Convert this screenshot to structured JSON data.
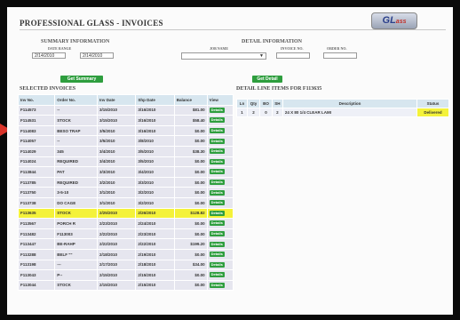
{
  "header": {
    "title": "PROFESSIONAL GLASS - INVOICES",
    "logo_text": "GL",
    "logo_sub": "ass"
  },
  "summary": {
    "heading": "SUMMARY INFORMATION",
    "date_range_label": "DATE RANGE",
    "date_from": "2/14/2010",
    "date_to": "2/14/2010",
    "button": "Get Summary"
  },
  "detail": {
    "heading": "DETAIL INFORMATION",
    "job_name_label": "JOB NAME",
    "invoice_no_label": "INVOICE NO.",
    "order_no_label": "ORDER NO.",
    "button": "Get Detail"
  },
  "invoices": {
    "heading": "SELECTED INVOICES",
    "columns": [
      "Inv No.",
      "Order No.",
      "Inv Date",
      "Shp Date",
      "Balance",
      "View"
    ],
    "rows": [
      [
        "F114573",
        "--",
        "3/15/2010",
        "3/16/2010",
        "$81.00",
        "Details"
      ],
      [
        "F114531",
        "STOCK",
        "3/15/2010",
        "3/16/2010",
        "$58.40",
        "Details"
      ],
      [
        "F114083",
        "BESO TRAP",
        "3/5/2010",
        "3/16/2010",
        "$0.00",
        "Details"
      ],
      [
        "F114057",
        "--",
        "3/5/2010",
        "3/8/2010",
        "$0.00",
        "Details"
      ],
      [
        "F114029",
        "345",
        "3/4/2010",
        "3/5/2010",
        "$38.30",
        "Details"
      ],
      [
        "F114024",
        "REQUIRED",
        "3/4/2010",
        "3/5/2010",
        "$0.00",
        "Details"
      ],
      [
        "F113844",
        "PAT",
        "3/3/2010",
        "3/4/2010",
        "$0.00",
        "Details"
      ],
      [
        "F113785",
        "REQUIRED",
        "3/2/2010",
        "3/3/2010",
        "$0.00",
        "Details"
      ],
      [
        "F113750",
        "3-5-10",
        "3/1/2010",
        "3/2/2010",
        "$0.00",
        "Details"
      ],
      [
        "F113738",
        "DO CAGE",
        "3/1/2010",
        "3/2/2010",
        "$0.00",
        "Details"
      ],
      [
        "F113635",
        "STOCK",
        "2/25/2010",
        "2/26/2010",
        "$128.82",
        "Details"
      ],
      [
        "F113567",
        "PORCH R",
        "2/23/2010",
        "2/24/2010",
        "$0.00",
        "Details"
      ],
      [
        "F113482",
        "F113003",
        "2/22/2010",
        "2/23/2010",
        "$0.00",
        "Details"
      ],
      [
        "F113447",
        "BE-RAHP",
        "2/22/2010",
        "2/22/2010",
        "$199.20",
        "Details"
      ],
      [
        "F113288",
        "BELF \"\"",
        "2/18/2010",
        "2/19/2010",
        "$0.00",
        "Details"
      ],
      [
        "F113198",
        "---",
        "2/17/2010",
        "2/18/2010",
        "$34.00",
        "Details"
      ],
      [
        "F113043",
        "P--",
        "2/15/2010",
        "2/15/2010",
        "$0.00",
        "Details"
      ],
      [
        "F113044",
        "STOCK",
        "2/15/2010",
        "2/15/2010",
        "$0.00",
        "Details"
      ]
    ],
    "highlighted_index": 10
  },
  "line_items": {
    "heading": "DETAIL LINE ITEMS FOR F113635",
    "columns": [
      "Ln",
      "Qty",
      "BO",
      "SH",
      "Description",
      "Status"
    ],
    "rows": [
      [
        "1",
        "2",
        "0",
        "2",
        "24 X 80 1/4 CLEAR LAMI",
        "Delivered"
      ]
    ]
  }
}
